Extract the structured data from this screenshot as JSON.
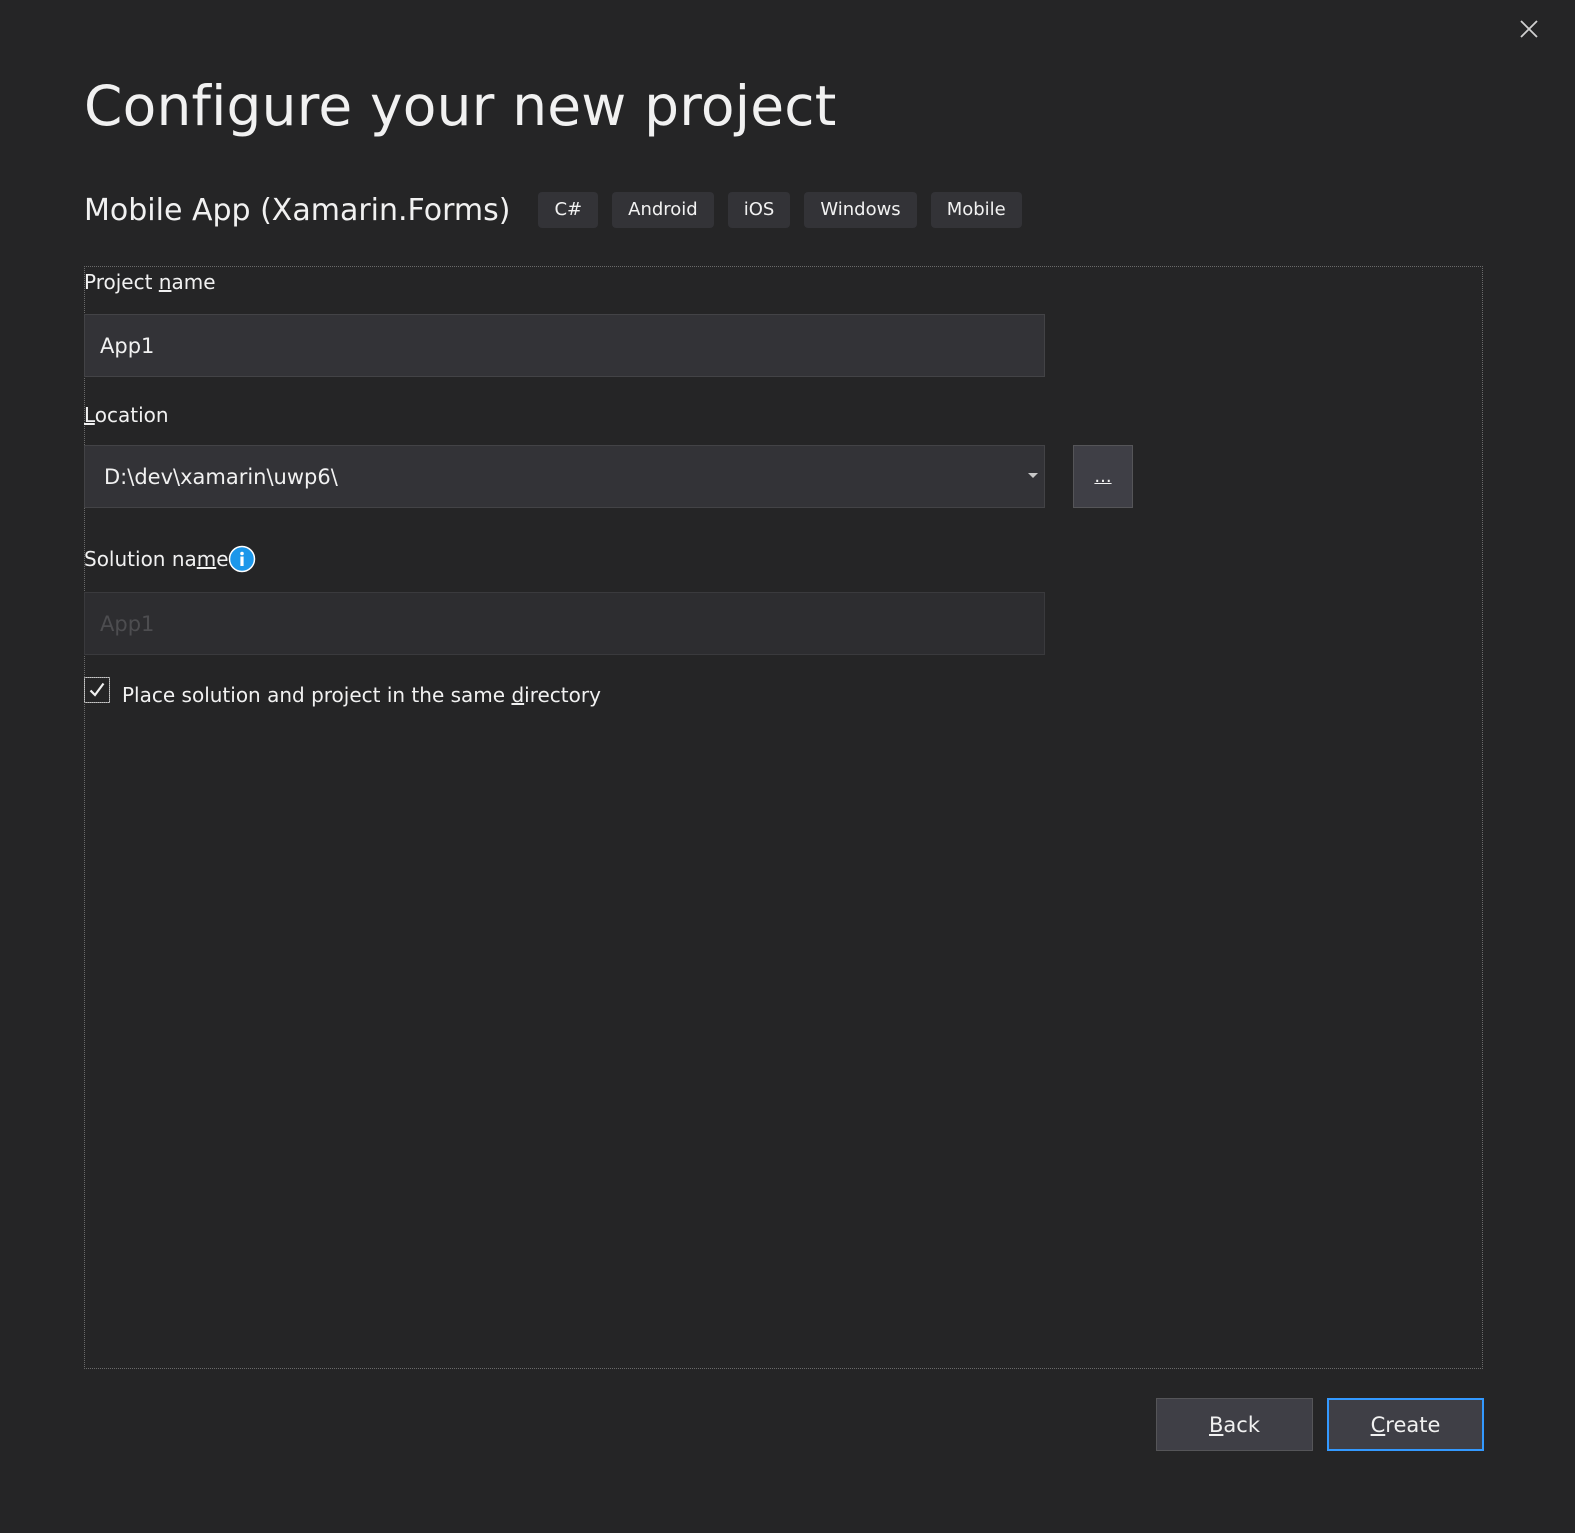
{
  "dialog": {
    "title": "Configure your new project",
    "close_icon": "close-icon"
  },
  "template": {
    "name": "Mobile App (Xamarin.Forms)",
    "tags": [
      "C#",
      "Android",
      "iOS",
      "Windows",
      "Mobile"
    ]
  },
  "project_name": {
    "label_pre": "Project ",
    "label_key": "n",
    "label_post": "ame",
    "value": "App1"
  },
  "location": {
    "label_pre": "",
    "label_key": "L",
    "label_post": "ocation",
    "value": "D:\\dev\\xamarin\\uwp6\\",
    "browse_label": "..."
  },
  "solution_name": {
    "label_pre": "Solution na",
    "label_key": "m",
    "label_post": "e",
    "placeholder": "App1",
    "info_icon": "info-icon"
  },
  "same_directory": {
    "checked": true,
    "label_pre": "Place solution and project in the same ",
    "label_key": "d",
    "label_post": "irectory"
  },
  "footer": {
    "back_key": "B",
    "back_rest": "ack",
    "create_key": "C",
    "create_rest": "reate"
  },
  "colors": {
    "background": "#252526",
    "input_bg": "#333337",
    "accent": "#3399ff"
  }
}
